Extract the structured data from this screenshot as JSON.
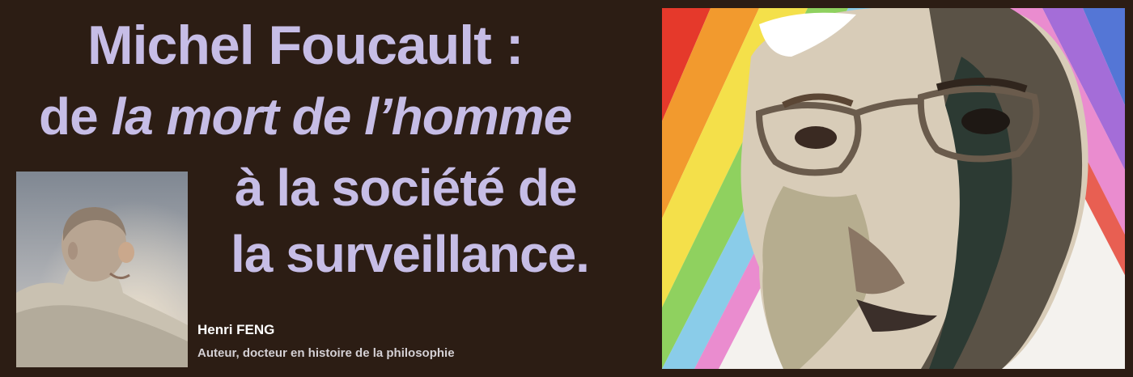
{
  "title": {
    "line1": "Michel Foucault :",
    "line2_prefix": "de ",
    "line2_italic": "la mort de l’homme",
    "line3": "à la société de",
    "line4": "la surveillance."
  },
  "author": {
    "name": "Henri FENG",
    "title": "Auteur, docteur en histoire de la philosophie"
  },
  "colors": {
    "background": "#2c1d14",
    "title": "#c6bde6",
    "author_name": "#ffffff",
    "author_title": "#d4d0d4"
  }
}
